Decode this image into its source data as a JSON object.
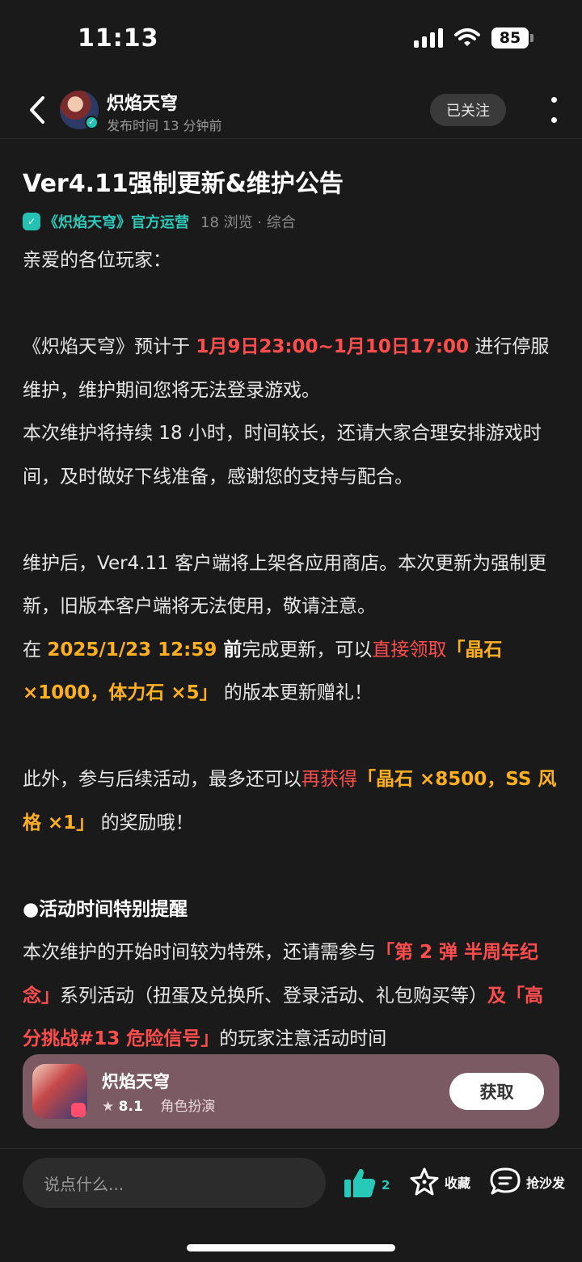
{
  "status_bar": {
    "time": "11:13",
    "battery": "85"
  },
  "header": {
    "author": "炽焰天穹",
    "publish_time": "发布时间 13 分钟前",
    "follow_label": "已关注"
  },
  "post": {
    "title": "Ver4.11强制更新&维护公告",
    "official_tag": "《炽焰天穹》官方运营",
    "stats": "18 浏览 · 综合",
    "greeting": "亲爱的各位玩家：",
    "p1_a": "《炽焰天穹》预计于 ",
    "p1_red": "1月9日23:00~1月10日17:00",
    "p1_b": " 进行停服维护，维护期间您将无法登录游戏。",
    "p2": "本次维护将持续 18 小时，时间较长，还请大家合理安排游戏时间，及时做好下线准备，感谢您的支持与配合。",
    "p3": " 维护后，Ver4.11 客户端将上架各应用商店。本次更新为强制更新，旧版本客户端将无法使用，敬请注意。",
    "p4_a": "在 ",
    "p4_orange": "2025/1/23 12:59",
    "p4_bold": " 前",
    "p4_b": "完成更新，可以",
    "p4_red": "直接领取",
    "p4_orange2": "「晶石 ×1000，体力石 ×5」",
    "p4_c": " 的版本更新赠礼！",
    "p5_a": " 此外，参与后续活动，最多还可以",
    "p5_red": "再获得",
    "p5_orange": "「晶石 ×8500，SS 风格 ×1」",
    "p5_b": " 的奖励哦！",
    "p6_heading": " ●活动时间特别提醒",
    "p7_a": "  本次维护的开始时间较为特殊，还请需参与",
    "p7_red": "「第 2 弹 半周年纪念」",
    "p7_b": "系列活动（扭蛋及兑换所、登录活动、礼包购买等）",
    "p7_red2": "及「高分挑战#13 危险信号」",
    "p7_c": "的玩家注意活动时间"
  },
  "app_banner": {
    "name": "炽焰天穹",
    "rating": "8.1",
    "genre": "角色扮演",
    "get_label": "获取"
  },
  "bottom_bar": {
    "comment_placeholder": "说点什么...",
    "like_count": "2",
    "favorite_label": "收藏",
    "reply_label": "抢沙发"
  },
  "colors": {
    "accent": "#27c9b9",
    "highlight_red": "#ff4d4d",
    "highlight_orange": "#ffb020"
  }
}
